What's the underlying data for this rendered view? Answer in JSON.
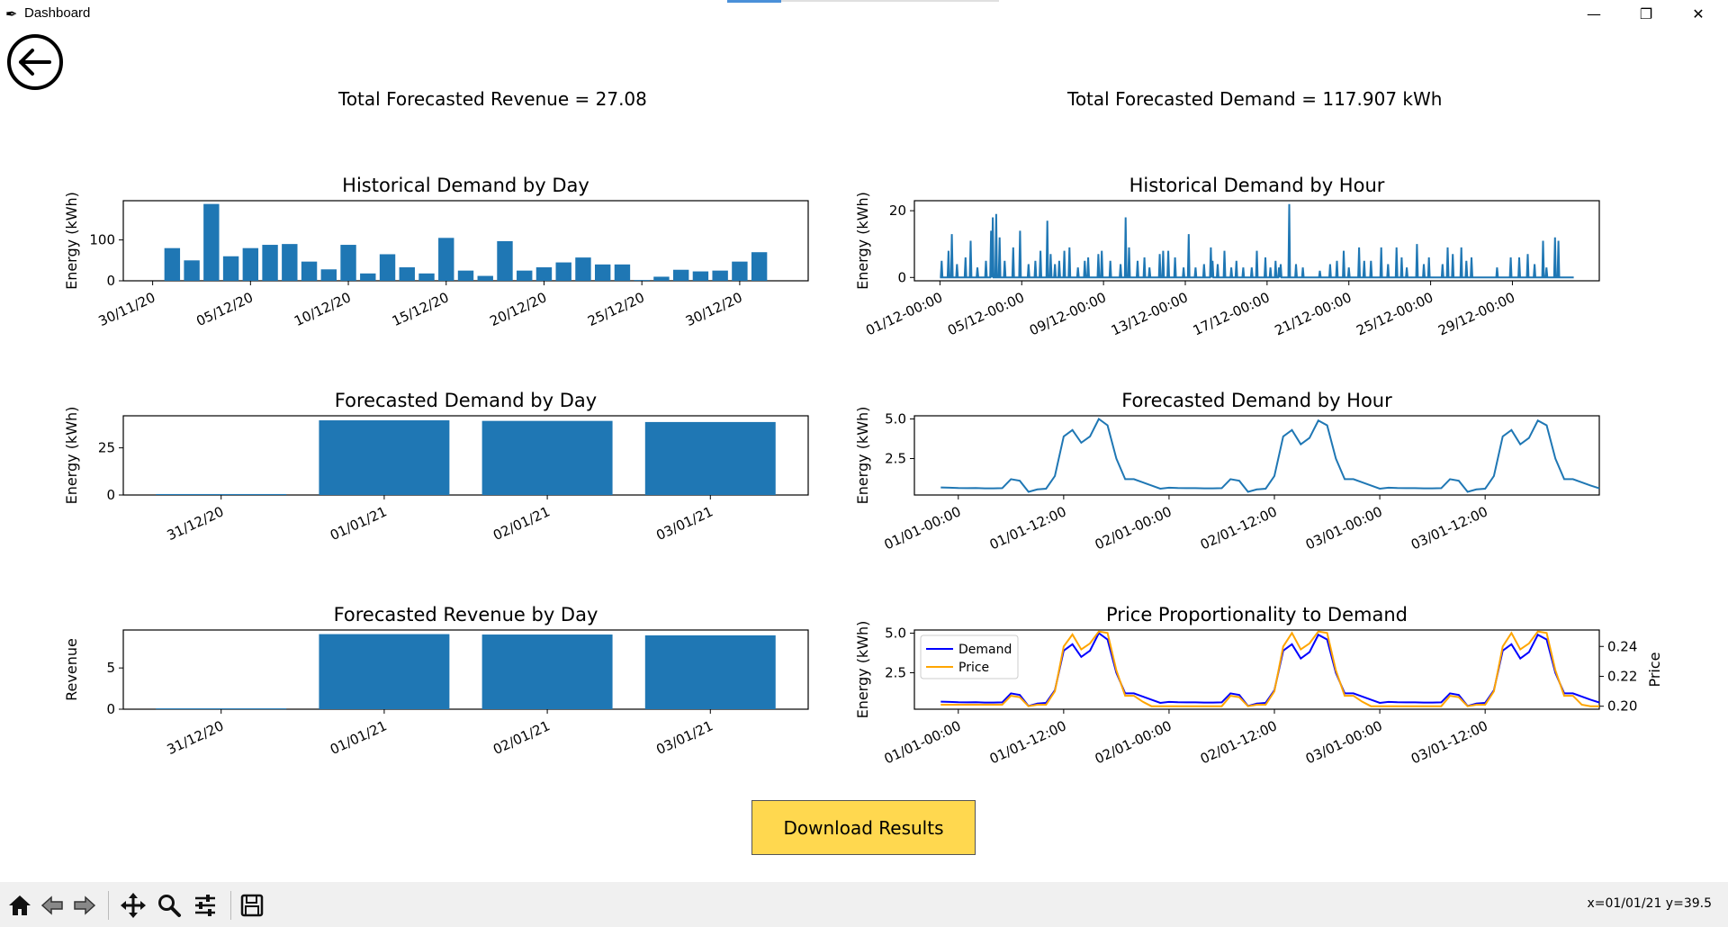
{
  "window": {
    "title": "Dashboard",
    "minimize": "—",
    "maximize": "❐",
    "close": "✕"
  },
  "header": {
    "total_revenue": "Total Forecasted Revenue = 27.08",
    "total_demand": "Total Forecasted Demand = 117.907 kWh"
  },
  "download_button": "Download Results",
  "toolbar": {
    "coords": "x=01/01/21 y=39.5"
  },
  "colors": {
    "bar": "#1f77b4",
    "line": "#1f77b4",
    "demand": "#0000ff",
    "price": "#ffa500",
    "button": "#ffd84f"
  },
  "chart_data": [
    {
      "id": "hist_day",
      "type": "bar",
      "title": "Historical Demand by Day",
      "ylabel": "Energy (kWh)",
      "xlabel": "",
      "ylim": [
        0,
        196
      ],
      "yticks": [
        0,
        100
      ],
      "tick_labels": [
        "30/11/20",
        "05/12/20",
        "10/12/20",
        "15/12/20",
        "20/12/20",
        "25/12/20",
        "30/12/20"
      ],
      "tick_positions": [
        1,
        6,
        11,
        16,
        21,
        26,
        31
      ],
      "x": [
        2,
        3,
        4,
        5,
        6,
        7,
        8,
        9,
        10,
        11,
        12,
        13,
        14,
        15,
        16,
        17,
        18,
        19,
        20,
        21,
        22,
        23,
        24,
        25,
        26,
        27,
        28,
        29,
        30,
        31,
        32,
        33
      ],
      "values": [
        80,
        50,
        188,
        60,
        80,
        88,
        90,
        47,
        28,
        88,
        18,
        65,
        33,
        18,
        105,
        25,
        12,
        97,
        25,
        33,
        45,
        57,
        40,
        40,
        2,
        10,
        27,
        23,
        25,
        47,
        70,
        0
      ]
    },
    {
      "id": "hist_hour",
      "type": "line",
      "title": "Historical Demand by Hour",
      "ylabel": "Energy (kWh)",
      "xlabel": "",
      "ylim": [
        -1,
        23
      ],
      "yticks": [
        0,
        20
      ],
      "tick_labels": [
        "01/12-00:00",
        "05/12-00:00",
        "09/12-00:00",
        "13/12-00:00",
        "17/12-00:00",
        "21/12-00:00",
        "25/12-00:00",
        "29/12-00:00"
      ],
      "tick_positions": [
        0,
        96,
        192,
        288,
        384,
        480,
        576,
        672
      ],
      "series": [
        {
          "peaks": [
            [
              2,
              5
            ],
            [
              10,
              8
            ],
            [
              14,
              13
            ],
            [
              20,
              4
            ],
            [
              30,
              6
            ],
            [
              36,
              11
            ],
            [
              44,
              3
            ],
            [
              54,
              5
            ],
            [
              60,
              14
            ],
            [
              62,
              18
            ],
            [
              66,
              19
            ],
            [
              70,
              12
            ],
            [
              76,
              5
            ],
            [
              86,
              9
            ],
            [
              94,
              14
            ],
            [
              104,
              4
            ],
            [
              112,
              5
            ],
            [
              118,
              8
            ],
            [
              126,
              17
            ],
            [
              130,
              7
            ],
            [
              135,
              4
            ],
            [
              140,
              5
            ],
            [
              146,
              8
            ],
            [
              152,
              9
            ],
            [
              162,
              3
            ],
            [
              170,
              5
            ],
            [
              174,
              6
            ],
            [
              186,
              7
            ],
            [
              190,
              8
            ],
            [
              200,
              5
            ],
            [
              212,
              4
            ],
            [
              218,
              18
            ],
            [
              222,
              9
            ],
            [
              232,
              5
            ],
            [
              240,
              6
            ],
            [
              246,
              3
            ],
            [
              258,
              7
            ],
            [
              262,
              8
            ],
            [
              268,
              8
            ],
            [
              276,
              6
            ],
            [
              286,
              3
            ],
            [
              292,
              13
            ],
            [
              300,
              3
            ],
            [
              310,
              4
            ],
            [
              318,
              9
            ],
            [
              320,
              5
            ],
            [
              326,
              4
            ],
            [
              334,
              8
            ],
            [
              342,
              3
            ],
            [
              348,
              5
            ],
            [
              356,
              3
            ],
            [
              366,
              3
            ],
            [
              372,
              8
            ],
            [
              382,
              6
            ],
            [
              388,
              3
            ],
            [
              394,
              5
            ],
            [
              398,
              3
            ],
            [
              400,
              4
            ],
            [
              410,
              22
            ],
            [
              418,
              4
            ],
            [
              426,
              3
            ],
            [
              446,
              2
            ],
            [
              458,
              4
            ],
            [
              466,
              5
            ],
            [
              474,
              8
            ],
            [
              480,
              3
            ],
            [
              492,
              9
            ],
            [
              498,
              5
            ],
            [
              506,
              5
            ],
            [
              518,
              9
            ],
            [
              526,
              4
            ],
            [
              536,
              9
            ],
            [
              542,
              6
            ],
            [
              548,
              3
            ],
            [
              560,
              10
            ],
            [
              568,
              4
            ],
            [
              574,
              6
            ],
            [
              590,
              4
            ],
            [
              596,
              9
            ],
            [
              602,
              7
            ],
            [
              612,
              9
            ],
            [
              618,
              5
            ],
            [
              624,
              6
            ],
            [
              654,
              3
            ],
            [
              670,
              6
            ],
            [
              680,
              6
            ],
            [
              690,
              7
            ],
            [
              698,
              4
            ],
            [
              708,
              11
            ],
            [
              712,
              3
            ],
            [
              722,
              12
            ],
            [
              726,
              11
            ]
          ],
          "x_end": 744,
          "baseline": 0
        }
      ]
    },
    {
      "id": "fc_day",
      "type": "bar",
      "title": "Forecasted Demand by Day",
      "ylabel": "Energy (kWh)",
      "xlabel": "",
      "ylim": [
        0,
        42
      ],
      "yticks": [
        0,
        25
      ],
      "categories": [
        "31/12/20",
        "01/01/21",
        "02/01/21",
        "03/01/21"
      ],
      "values": [
        0.5,
        39.6,
        39.3,
        38.7
      ]
    },
    {
      "id": "fc_hour",
      "type": "line",
      "title": "Forecasted Demand by Hour",
      "ylabel": "Energy (kWh)",
      "xlabel": "",
      "ylim": [
        0.2,
        5.2
      ],
      "yticks": [
        2.5,
        5.0
      ],
      "tick_labels": [
        "01/01-00:00",
        "01/01-12:00",
        "02/01-00:00",
        "02/01-12:00",
        "03/01-00:00",
        "03/01-12:00"
      ],
      "tick_positions": [
        0,
        12,
        24,
        36,
        48,
        60
      ],
      "series": [
        {
          "name": "Demand",
          "values": [
            0.68,
            0.66,
            0.64,
            0.63,
            0.64,
            0.62,
            0.62,
            0.63,
            1.2,
            1.1,
            0.4,
            0.55,
            0.6,
            1.4,
            3.9,
            4.3,
            3.5,
            3.9,
            5.0,
            4.6,
            2.5,
            1.2,
            1.2,
            1.0,
            0.8,
            0.6,
            0.66,
            0.64,
            0.63,
            0.63,
            0.62,
            0.62,
            0.63,
            1.2,
            1.1,
            0.4,
            0.55,
            0.6,
            1.4,
            3.9,
            4.3,
            3.4,
            3.8,
            4.9,
            4.6,
            2.5,
            1.2,
            1.2,
            1.0,
            0.8,
            0.6,
            0.66,
            0.64,
            0.63,
            0.63,
            0.62,
            0.62,
            0.63,
            1.2,
            1.1,
            0.4,
            0.55,
            0.6,
            1.4,
            3.9,
            4.3,
            3.4,
            3.8,
            4.9,
            4.6,
            2.5,
            1.2,
            1.2,
            1.0,
            0.8,
            0.62
          ],
          "x_start": -2
        }
      ]
    },
    {
      "id": "fc_revenue",
      "type": "bar",
      "title": "Forecasted Revenue by Day",
      "ylabel": "Revenue",
      "xlabel": "",
      "ylim": [
        0,
        9.6
      ],
      "yticks": [
        0,
        5
      ],
      "categories": [
        "31/12/20",
        "01/01/21",
        "02/01/21",
        "03/01/21"
      ],
      "values": [
        0.1,
        9.1,
        9.05,
        8.95
      ]
    },
    {
      "id": "price_prop",
      "type": "line",
      "title": "Price Proportionality to Demand",
      "ylabel": "Energy (kWh)",
      "ylabel_right": "Price",
      "xlabel": "",
      "ylim": [
        0.2,
        5.2
      ],
      "ylim_right": [
        0.198,
        0.251
      ],
      "yticks": [
        2.5,
        5.0
      ],
      "yticks_right": [
        0.2,
        0.22,
        0.24
      ],
      "legend_position": "top-left",
      "tick_labels": [
        "01/01-00:00",
        "01/01-12:00",
        "02/01-00:00",
        "02/01-12:00",
        "03/01-00:00",
        "03/01-12:00"
      ],
      "tick_positions": [
        0,
        12,
        24,
        36,
        48,
        60
      ],
      "series": [
        {
          "name": "Demand",
          "axis": "left",
          "values": [
            0.68,
            0.66,
            0.64,
            0.63,
            0.64,
            0.62,
            0.62,
            0.63,
            1.2,
            1.1,
            0.4,
            0.55,
            0.6,
            1.4,
            3.9,
            4.3,
            3.5,
            3.9,
            5.0,
            4.6,
            2.5,
            1.2,
            1.2,
            1.0,
            0.8,
            0.6,
            0.66,
            0.64,
            0.63,
            0.63,
            0.62,
            0.62,
            0.63,
            1.2,
            1.1,
            0.4,
            0.55,
            0.6,
            1.4,
            3.9,
            4.3,
            3.4,
            3.8,
            4.9,
            4.6,
            2.5,
            1.2,
            1.2,
            1.0,
            0.8,
            0.6,
            0.66,
            0.64,
            0.63,
            0.63,
            0.62,
            0.62,
            0.63,
            1.2,
            1.1,
            0.4,
            0.55,
            0.6,
            1.4,
            3.9,
            4.3,
            3.4,
            3.8,
            4.9,
            4.6,
            2.5,
            1.2,
            1.2,
            1.0,
            0.8,
            0.62
          ],
          "x_start": -2
        },
        {
          "name": "Price",
          "axis": "right",
          "values": [
            0.201,
            0.201,
            0.201,
            0.201,
            0.201,
            0.201,
            0.201,
            0.201,
            0.207,
            0.206,
            0.2,
            0.201,
            0.201,
            0.21,
            0.24,
            0.248,
            0.238,
            0.242,
            0.25,
            0.249,
            0.224,
            0.207,
            0.207,
            0.203,
            0.2,
            0.2,
            0.2,
            0.2,
            0.2,
            0.2,
            0.2,
            0.2,
            0.2,
            0.207,
            0.206,
            0.2,
            0.201,
            0.201,
            0.21,
            0.24,
            0.249,
            0.238,
            0.242,
            0.25,
            0.249,
            0.224,
            0.207,
            0.207,
            0.203,
            0.2,
            0.2,
            0.2,
            0.2,
            0.2,
            0.2,
            0.2,
            0.2,
            0.2,
            0.207,
            0.206,
            0.2,
            0.201,
            0.201,
            0.21,
            0.24,
            0.249,
            0.238,
            0.242,
            0.25,
            0.249,
            0.224,
            0.207,
            0.207,
            0.201,
            0.2,
            0.2
          ],
          "x_start": -2
        }
      ]
    }
  ]
}
